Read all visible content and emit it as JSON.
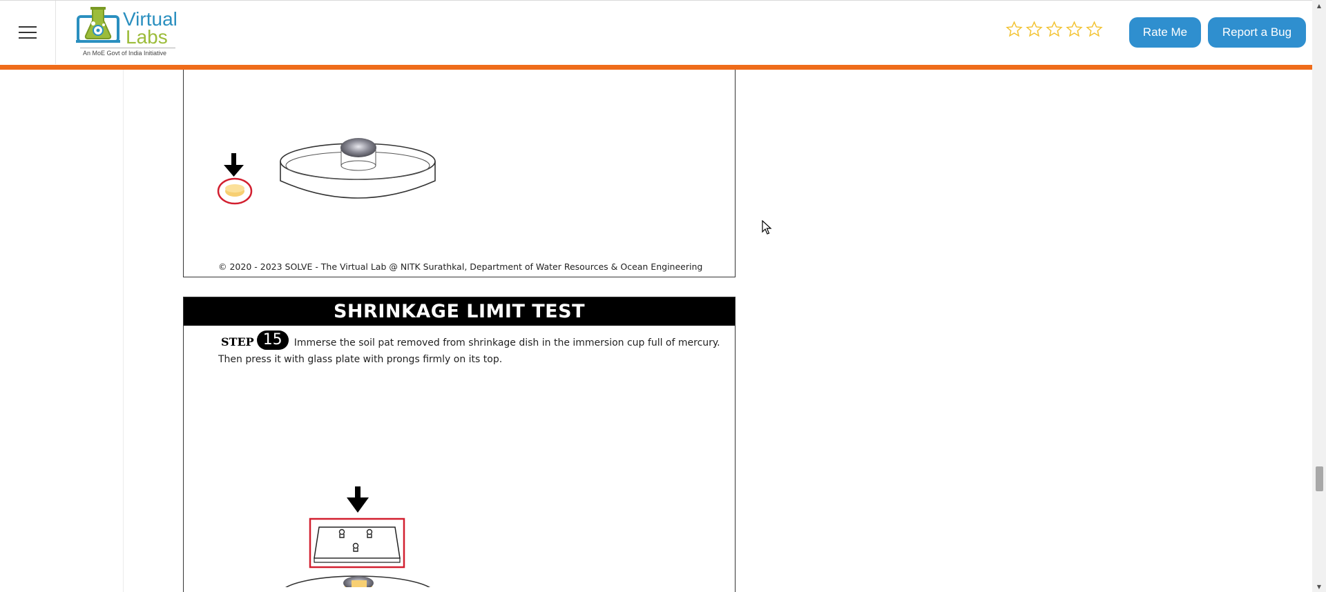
{
  "header": {
    "menu_icon": "hamburger-menu-icon",
    "logo": {
      "word1": "Virtual",
      "word2": "Labs",
      "tagline": "An MoE Govt of India Initiative",
      "colors": {
        "blue": "#2a8fbf",
        "green": "#9cbc3a"
      }
    },
    "rating": {
      "star_count": 5,
      "filled": 0,
      "star_color": "#f2c230"
    },
    "rate_label": "Rate Me",
    "bug_label": "Report a Bug",
    "accent_color": "#ef6c1a",
    "button_color": "#2f8fcf"
  },
  "content": {
    "upper_panel": {
      "copyright": "© 2020 - 2023 SOLVE - The Virtual Lab @ NITK Surathkal, Department of Water Resources & Ocean Engineering"
    },
    "lower_panel": {
      "title": "SHRINKAGE LIMIT TEST",
      "step_label": "STEP",
      "step_number": "15",
      "instruction_line1": "Immerse the soil pat removed from shrinkage dish in the immersion cup full of mercury.",
      "instruction_line2": "Then press it with glass plate with prongs firmly on its top."
    }
  }
}
